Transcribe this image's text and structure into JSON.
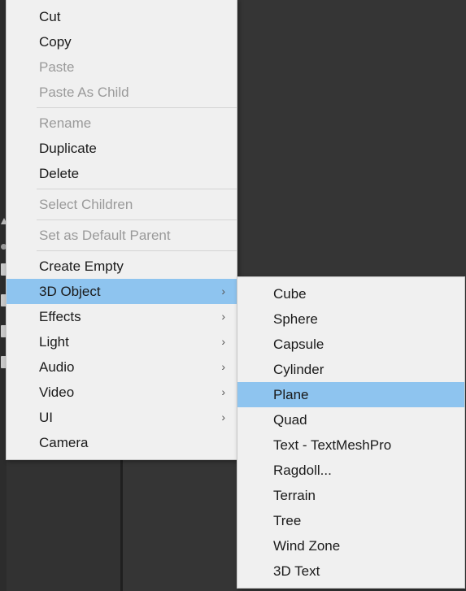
{
  "app": {
    "theme_background": "#333333",
    "menu_background": "#f0f0f0",
    "highlight_color": "#8ec4ef",
    "disabled_text_color": "#9a9a9a",
    "text_color": "#1a1a1a"
  },
  "context_menu": {
    "name": "hierarchy-context-menu",
    "items": [
      {
        "label": "Cut",
        "disabled": false,
        "submenu": false,
        "highlighted": false
      },
      {
        "label": "Copy",
        "disabled": false,
        "submenu": false,
        "highlighted": false
      },
      {
        "label": "Paste",
        "disabled": true,
        "submenu": false,
        "highlighted": false
      },
      {
        "label": "Paste As Child",
        "disabled": true,
        "submenu": false,
        "highlighted": false
      },
      {
        "separator": true
      },
      {
        "label": "Rename",
        "disabled": true,
        "submenu": false,
        "highlighted": false
      },
      {
        "label": "Duplicate",
        "disabled": false,
        "submenu": false,
        "highlighted": false
      },
      {
        "label": "Delete",
        "disabled": false,
        "submenu": false,
        "highlighted": false
      },
      {
        "separator": true
      },
      {
        "label": "Select Children",
        "disabled": true,
        "submenu": false,
        "highlighted": false
      },
      {
        "separator": true
      },
      {
        "label": "Set as Default Parent",
        "disabled": true,
        "submenu": false,
        "highlighted": false
      },
      {
        "separator": true
      },
      {
        "label": "Create Empty",
        "disabled": false,
        "submenu": false,
        "highlighted": false
      },
      {
        "label": "3D Object",
        "disabled": false,
        "submenu": true,
        "highlighted": true
      },
      {
        "label": "Effects",
        "disabled": false,
        "submenu": true,
        "highlighted": false
      },
      {
        "label": "Light",
        "disabled": false,
        "submenu": true,
        "highlighted": false
      },
      {
        "label": "Audio",
        "disabled": false,
        "submenu": true,
        "highlighted": false
      },
      {
        "label": "Video",
        "disabled": false,
        "submenu": true,
        "highlighted": false
      },
      {
        "label": "UI",
        "disabled": false,
        "submenu": true,
        "highlighted": false
      },
      {
        "label": "Camera",
        "disabled": false,
        "submenu": false,
        "highlighted": false
      }
    ],
    "submenu_arrow_glyph": "›"
  },
  "submenu": {
    "name": "3d-object-submenu",
    "parent_label": "3D Object",
    "items": [
      {
        "label": "Cube",
        "highlighted": false
      },
      {
        "label": "Sphere",
        "highlighted": false
      },
      {
        "label": "Capsule",
        "highlighted": false
      },
      {
        "label": "Cylinder",
        "highlighted": false
      },
      {
        "label": "Plane",
        "highlighted": true
      },
      {
        "label": "Quad",
        "highlighted": false
      },
      {
        "label": "Text - TextMeshPro",
        "highlighted": false
      },
      {
        "label": "Ragdoll...",
        "highlighted": false
      },
      {
        "label": "Terrain",
        "highlighted": false
      },
      {
        "label": "Tree",
        "highlighted": false
      },
      {
        "label": "Wind Zone",
        "highlighted": false
      },
      {
        "label": "3D Text",
        "highlighted": false
      }
    ]
  }
}
